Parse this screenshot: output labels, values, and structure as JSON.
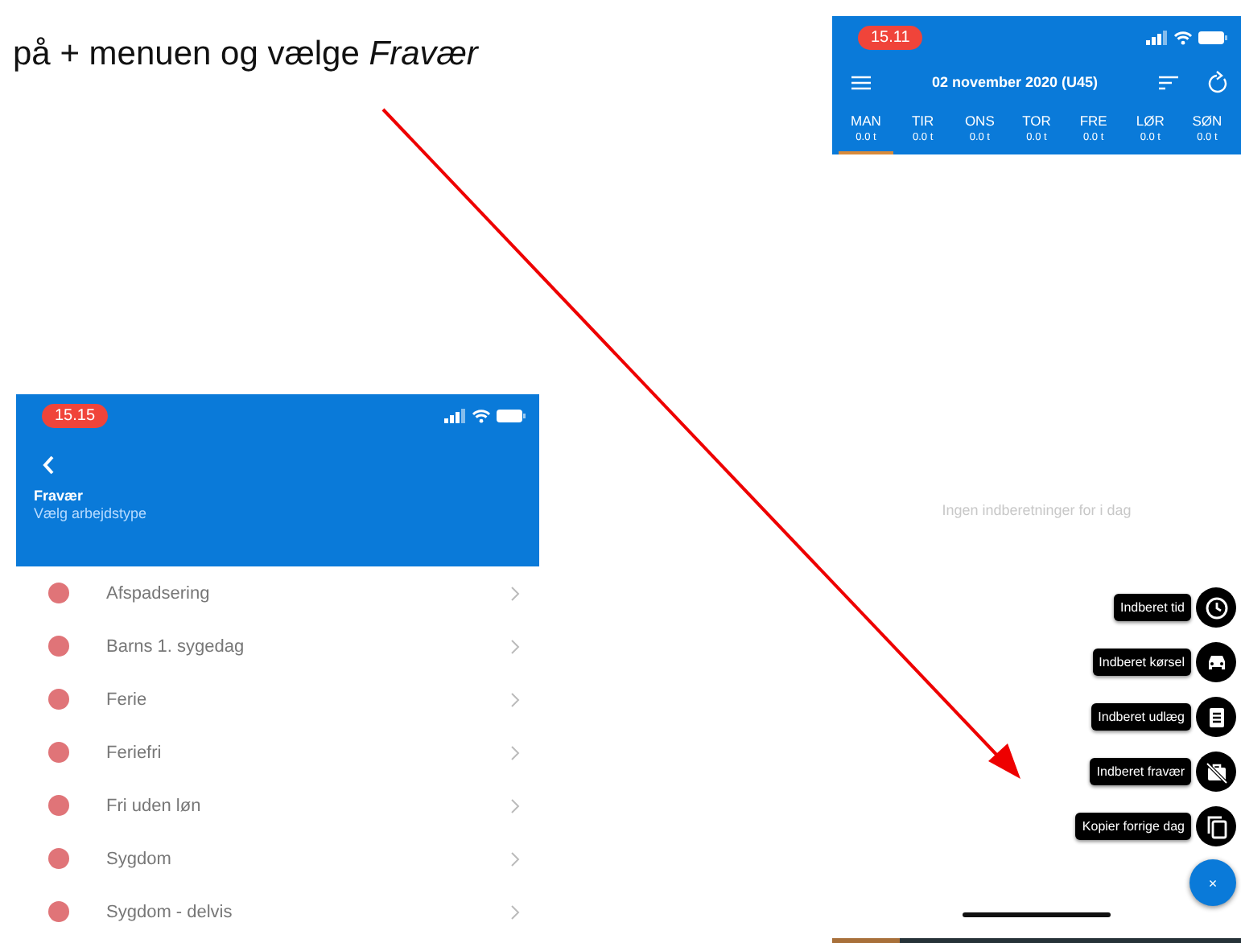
{
  "instruction": "på + menuen og vælge *Fravær*",
  "day_screen": {
    "status_time": "15.11",
    "title": "02 november 2020 (U45)",
    "days": [
      {
        "label": "MAN",
        "hours": "0.0 t",
        "selected": true
      },
      {
        "label": "TIR",
        "hours": "0.0 t",
        "selected": false
      },
      {
        "label": "ONS",
        "hours": "0.0 t",
        "selected": false
      },
      {
        "label": "TOR",
        "hours": "0.0 t",
        "selected": false
      },
      {
        "label": "FRE",
        "hours": "0.0 t",
        "selected": false
      },
      {
        "label": "LØR",
        "hours": "0.0 t",
        "selected": false
      },
      {
        "label": "SØN",
        "hours": "0.0 t",
        "selected": false
      }
    ],
    "empty_message": "Ingen indberetninger for i dag",
    "actions": [
      {
        "label": "Indberet tid",
        "kind": "time"
      },
      {
        "label": "Indberet kørsel",
        "kind": "driving"
      },
      {
        "label": "Indberet udlæg",
        "kind": "expense"
      },
      {
        "label": "Indberet fravær",
        "kind": "absence"
      },
      {
        "label": "Kopier forrige dag",
        "kind": "copy"
      }
    ],
    "fab": "×"
  },
  "absence_screen": {
    "status_time": "15.15",
    "title": "Fravær",
    "subtitle": "Vælg arbejdstype",
    "items": [
      {
        "label": "Afspadsering"
      },
      {
        "label": "Barns 1. sygedag"
      },
      {
        "label": "Ferie"
      },
      {
        "label": "Feriefri"
      },
      {
        "label": "Fri uden løn"
      },
      {
        "label": "Sygdom"
      },
      {
        "label": "Sygdom - delvis"
      }
    ]
  }
}
